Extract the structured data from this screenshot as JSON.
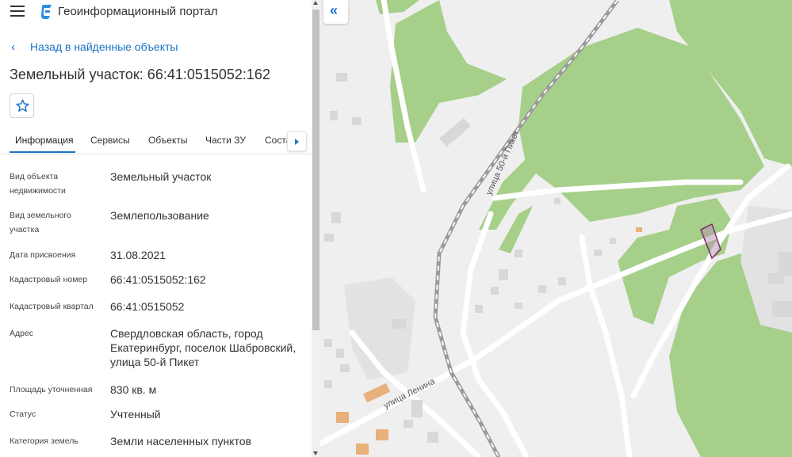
{
  "app": {
    "title": "Геоинформационный портал"
  },
  "back": {
    "label": "Назад в найденные объекты",
    "chevron": "‹"
  },
  "object": {
    "title": "Земельный участок: 66:41:0515052:162"
  },
  "tabs": [
    {
      "label": "Информация",
      "active": true
    },
    {
      "label": "Сервисы"
    },
    {
      "label": "Объекты"
    },
    {
      "label": "Части ЗУ"
    },
    {
      "label": "Соста"
    }
  ],
  "info": [
    {
      "label": "Вид объекта недвижимости",
      "value": "Земельный участок"
    },
    {
      "label": "Вид земельного участка",
      "value": "Землепользование"
    },
    {
      "label": "Дата присвоения",
      "value": "31.08.2021"
    },
    {
      "label": "Кадастровый номер",
      "value": "66:41:0515052:162"
    },
    {
      "label": "Кадастровый квартал",
      "value": "66:41:0515052"
    },
    {
      "label": "Адрес",
      "value": "Свердловская область, город Екатеринбург, поселок Шабровский, улица 50-й Пикет"
    },
    {
      "label": "Площадь уточненная",
      "value": "830 кв. м"
    },
    {
      "label": "Статус",
      "value": "Учтенный"
    },
    {
      "label": "Категория земель",
      "value": "Земли населенных пунктов"
    }
  ],
  "map": {
    "collapse_icon": "«",
    "street_labels": [
      "улица 50-й Пикет",
      "улица Ленина"
    ],
    "colors": {
      "forest": "#a6cf8a",
      "background": "#efefef",
      "road": "#ffffff",
      "railway": "#9a9a9a",
      "building": "#d8d8d8",
      "highlight": "#e8b07a",
      "parcel_outline": "#7b2d6b"
    }
  },
  "icons": {
    "menu": "menu-icon",
    "logo": "portal-logo-icon",
    "favorite": "star-icon",
    "back": "chevron-left-icon",
    "tab_scroll": "chevron-right-icon",
    "collapse": "double-chevron-left-icon"
  }
}
